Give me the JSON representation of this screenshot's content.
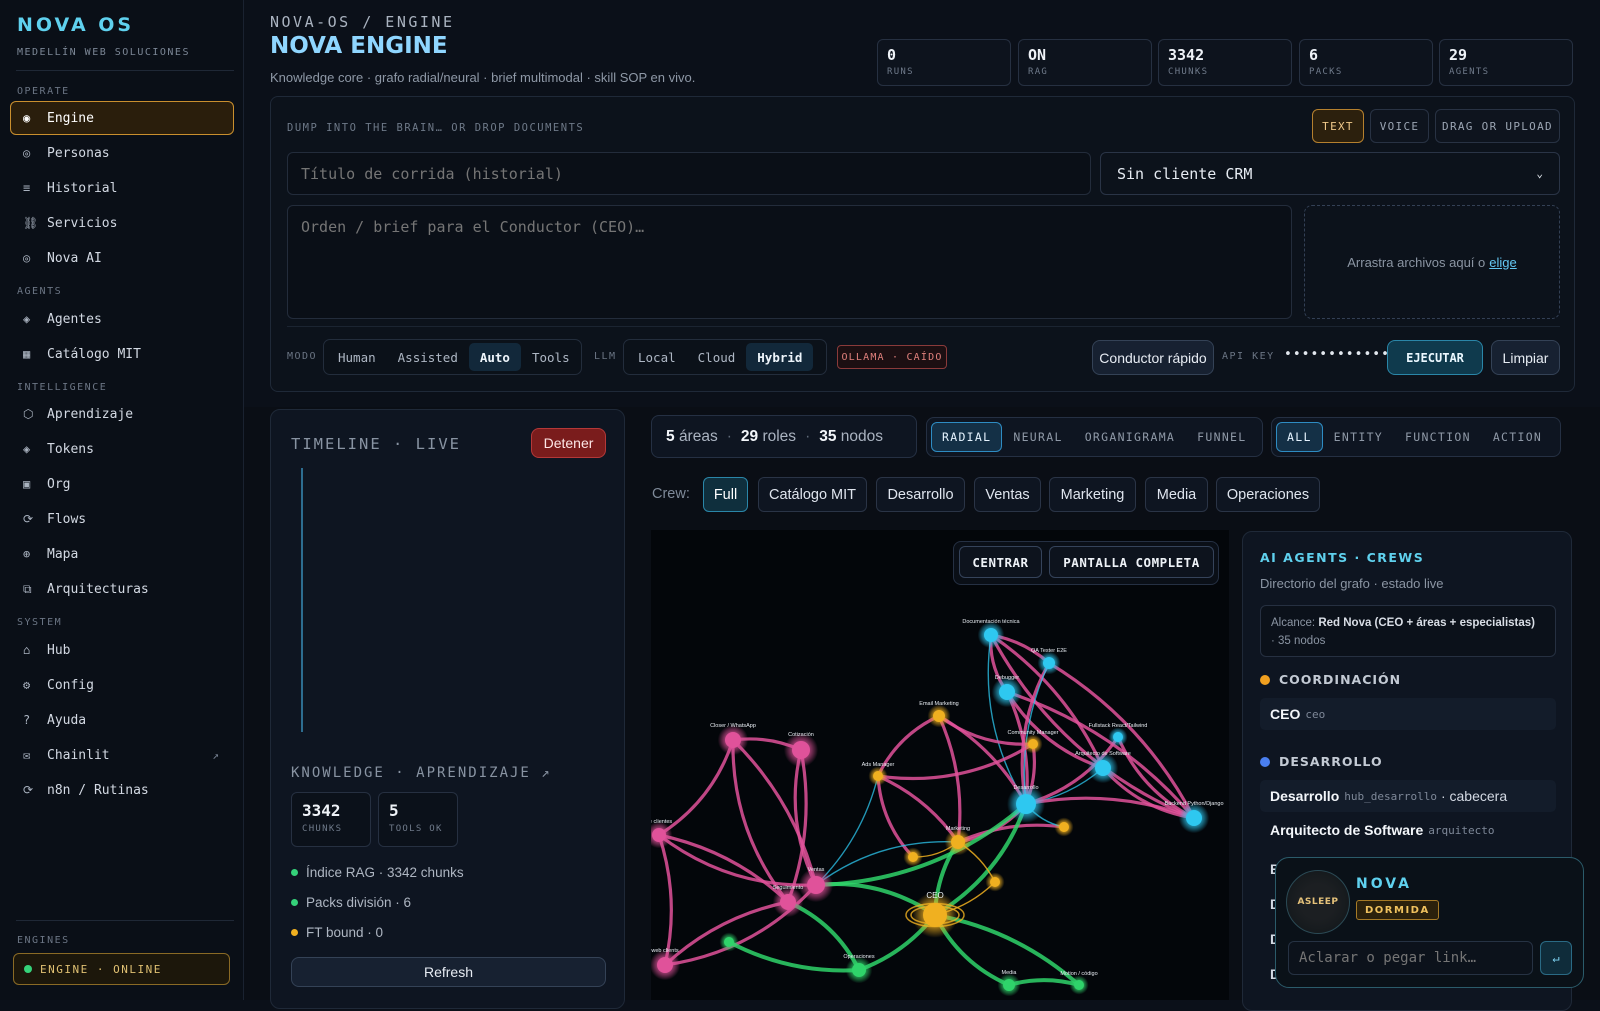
{
  "sidebar": {
    "brand": "NOVA OS",
    "brand_sub": "MEDELLÍN WEB SOLUCIONES",
    "sections": {
      "operate": "OPERATE",
      "agents": "AGENTS",
      "intelligence": "INTELLIGENCE",
      "system": "SYSTEM",
      "engines": "ENGINES"
    },
    "items": {
      "engine": "Engine",
      "personas": "Personas",
      "historial": "Historial",
      "servicios": "Servicios",
      "nova_ai": "Nova AI",
      "agentes": "Agentes",
      "catalogo": "Catálogo MIT",
      "aprendizaje": "Aprendizaje",
      "tokens": "Tokens",
      "org": "Org",
      "flows": "Flows",
      "mapa": "Mapa",
      "arquitecturas": "Arquitecturas",
      "hub": "Hub",
      "config": "Config",
      "ayuda": "Ayuda",
      "chainlit": "Chainlit",
      "n8n": "n8n / Rutinas"
    },
    "engine_status": "ENGINE · ONLINE"
  },
  "header": {
    "breadcrumb": "NOVA-OS / ENGINE",
    "title": "NOVA ENGINE",
    "subtitle": "Knowledge core · grafo radial/neural · brief multimodal · skill SOP en vivo."
  },
  "stats": {
    "runs": {
      "value": "0",
      "label": "RUNS"
    },
    "rag": {
      "value": "ON",
      "label": "RAG"
    },
    "chunks": {
      "value": "3342",
      "label": "CHUNKS"
    },
    "packs": {
      "value": "6",
      "label": "PACKS"
    },
    "agents": {
      "value": "29",
      "label": "AGENTS"
    }
  },
  "input": {
    "dump_label": "DUMP INTO THE BRAIN… OR DROP DOCUMENTS",
    "modes": {
      "text": "TEXT",
      "voice": "VOICE",
      "upload": "DRAG OR UPLOAD"
    },
    "title_placeholder": "Título de corrida (historial)",
    "crm_value": "Sin cliente CRM",
    "brief_placeholder": "Orden / brief para el Conductor (CEO)…",
    "drop_text": "Arrastra archivos aquí o",
    "drop_link": "elige",
    "modo_label": "MODO",
    "modo_options": {
      "human": "Human",
      "assisted": "Assisted",
      "auto": "Auto",
      "tools": "Tools"
    },
    "llm_label": "LLM",
    "llm_options": {
      "local": "Local",
      "cloud": "Cloud",
      "hybrid": "Hybrid"
    },
    "ollama_status": "OLLAMA · CAÍDO",
    "conductor_label": "Conductor rápido",
    "api_key_label": "API KEY",
    "api_key_value": "••••••••••••",
    "ejecutar_label": "EJECUTAR",
    "limpiar_label": "Limpiar"
  },
  "timeline": {
    "title": "TIMELINE · LIVE",
    "stop_label": "Detener",
    "knowledge_title": "KNOWLEDGE · APRENDIZAJE ↗",
    "chunks": {
      "value": "3342",
      "label": "CHUNKS"
    },
    "tools": {
      "value": "5",
      "label": "TOOLS OK"
    },
    "items": [
      "Índice RAG · 3342 chunks",
      "Packs división · 6",
      "FT bound · 0"
    ],
    "refresh_label": "Refresh"
  },
  "graph": {
    "counts": {
      "areas": "5",
      "areas_label": "áreas",
      "roles": "29",
      "roles_label": "roles",
      "nodes": "35",
      "nodes_label": "nodos"
    },
    "views": {
      "radial": "RADIAL",
      "neural": "NEURAL",
      "organigrama": "ORGANIGRAMA",
      "funnel": "FUNNEL"
    },
    "filters": {
      "all": "ALL",
      "entity": "ENTITY",
      "function": "FUNCTION",
      "action": "ACTION"
    },
    "crew_label": "Crew:",
    "crews": {
      "full": "Full",
      "catalogo": "Catálogo MIT",
      "desarrollo": "Desarrollo",
      "ventas": "Ventas",
      "marketing": "Marketing",
      "media": "Media",
      "operaciones": "Operaciones"
    },
    "center_label": "CENTRAR",
    "fullscreen_label": "PANTALLA COMPLETA",
    "node_labels": {
      "doc": "Documentación técnica",
      "qa": "QA Tester E2E",
      "debugger": "Debugger",
      "arquitecto": "Arquitecto de Software",
      "desarrollo": "Desarrollo",
      "backend": "Backend Python/Django",
      "fullstack": "Fullstack React/Tailwind",
      "closer": "Closer / WhatsApp",
      "cotizacion": "Cotización",
      "email": "Email Marketing",
      "ads": "Ads Manager",
      "community": "Community Manager",
      "marketing": "Marketing",
      "ventas": "Ventas",
      "seguimiento": "Seguimiento",
      "ceo": "CEO",
      "clientes": "de clientes",
      "operaciones": "Operaciones",
      "media": "Media",
      "motion": "Motion / código",
      "web": "web clients"
    }
  },
  "agents_panel": {
    "title": "AI AGENTS · CREWS",
    "subtitle": "Directorio del grafo · estado live",
    "scope_label": "Alcance:",
    "scope_value": "Red Nova (CEO + áreas + especialistas)",
    "scope_nodes": "· 35 nodos",
    "sections": {
      "coordinacion": "COORDINACIÓN",
      "desarrollo": "DESARROLLO"
    },
    "ceo": {
      "name": "CEO",
      "slug": "ceo"
    },
    "desarrollo": {
      "name": "Desarrollo",
      "slug": "hub_desarrollo",
      "tag": "· cabecera"
    },
    "arquitecto": {
      "name": "Arquitecto de Software",
      "slug": "arquitecto"
    },
    "stubs": [
      "B",
      "D",
      "D",
      "D"
    ]
  },
  "nova": {
    "ring_label": "ASLEEP",
    "name": "NOVA",
    "status": "DORMIDA",
    "input_placeholder": "Aclarar o pegar link…",
    "send_icon": "↵"
  },
  "colors": {
    "accent": "#5fd1ee",
    "active_border": "#c98f2e",
    "online": "#35d27a",
    "danger": "#b43838",
    "graph_pink": "#e0529a",
    "graph_green": "#2fd36a",
    "graph_cyan": "#2ec8f0",
    "graph_gold": "#f0b020"
  }
}
